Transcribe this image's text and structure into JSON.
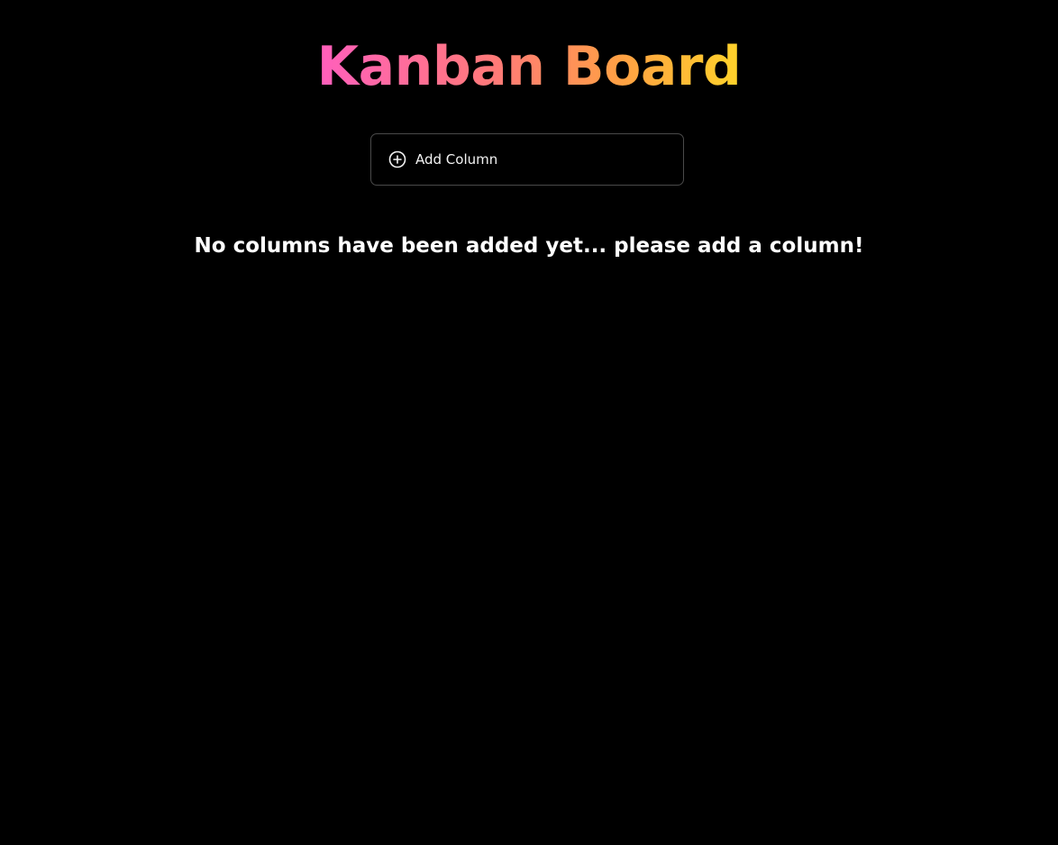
{
  "header": {
    "title": "Kanban Board"
  },
  "toolbar": {
    "add_column_label": "Add Column",
    "add_column_icon": "plus-circle-icon"
  },
  "board": {
    "empty_message": "No columns have been added yet... please add a column!"
  },
  "colors": {
    "background": "#000000",
    "title_gradient_start": "#ff5fbd",
    "title_gradient_end": "#ffd32a",
    "button_border": "#4a4a4a",
    "text": "#ffffff"
  }
}
